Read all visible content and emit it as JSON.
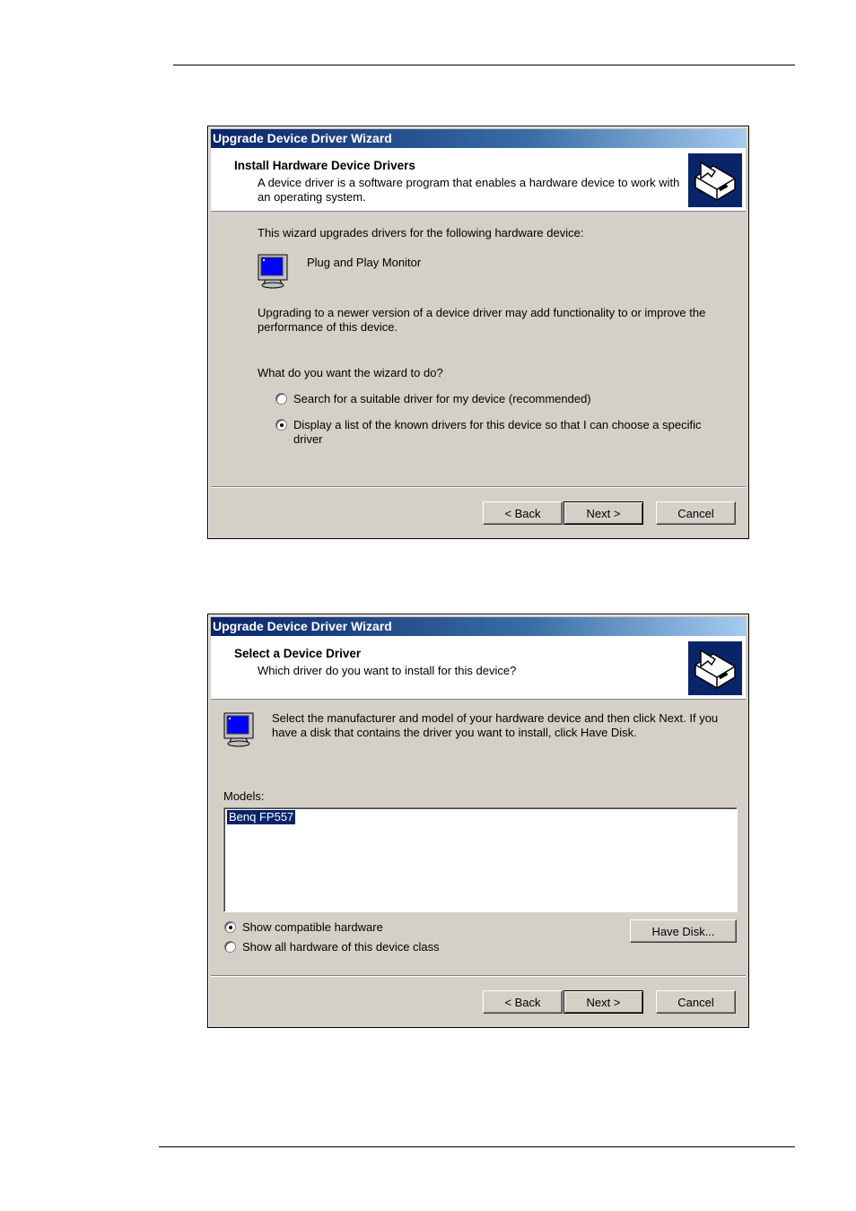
{
  "dialog1": {
    "title": "Upgrade Device Driver Wizard",
    "header_title": "Install Hardware Device Drivers",
    "header_subtitle": "A device driver is a software program that enables a hardware device to work with an operating system.",
    "intro": "This wizard upgrades drivers for the following hardware device:",
    "device_name": "Plug and Play Monitor",
    "upgrade_text": "Upgrading to a newer version of a device driver may add functionality to or improve the performance of this device.",
    "question": "What do you want the wizard to do?",
    "option_search": "Search for a suitable driver for my device (recommended)",
    "option_display": "Display a list of the known drivers for this device so that I can choose a specific driver",
    "back_label": "< Back",
    "next_label": "Next >",
    "cancel_label": "Cancel"
  },
  "dialog2": {
    "title": "Upgrade Device Driver Wizard",
    "header_title": "Select a Device Driver",
    "header_subtitle": "Which driver do you want to install for this device?",
    "instructions": "Select the manufacturer and model of your hardware device and then click Next. If you have a disk that contains the driver you want to install, click Have Disk.",
    "models_label": "Models:",
    "models": [
      "Benq FP557"
    ],
    "show_compatible": "Show compatible hardware",
    "show_all": "Show all hardware of this device class",
    "have_disk_label": "Have Disk...",
    "back_label": "< Back",
    "next_label": "Next >",
    "cancel_label": "Cancel"
  }
}
